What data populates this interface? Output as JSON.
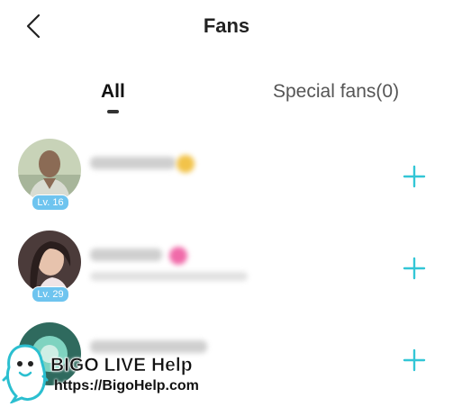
{
  "header": {
    "title": "Fans",
    "back_icon": "chevron-left-icon"
  },
  "tabs": [
    {
      "label": "All",
      "active": true
    },
    {
      "label": "Special fans(0)",
      "active": false
    }
  ],
  "fans": [
    {
      "level": "Lv. 16",
      "follow_icon": "plus-icon"
    },
    {
      "level": "Lv. 29",
      "follow_icon": "plus-icon"
    },
    {
      "level": "",
      "follow_icon": "plus-icon"
    }
  ],
  "colors": {
    "accent": "#33c6d6",
    "level_badge": "#6ec4ef",
    "tab_indicator": "#333333"
  },
  "watermark": {
    "title": "BIGO LIVE Help",
    "url": "https://BigoHelp.com"
  }
}
